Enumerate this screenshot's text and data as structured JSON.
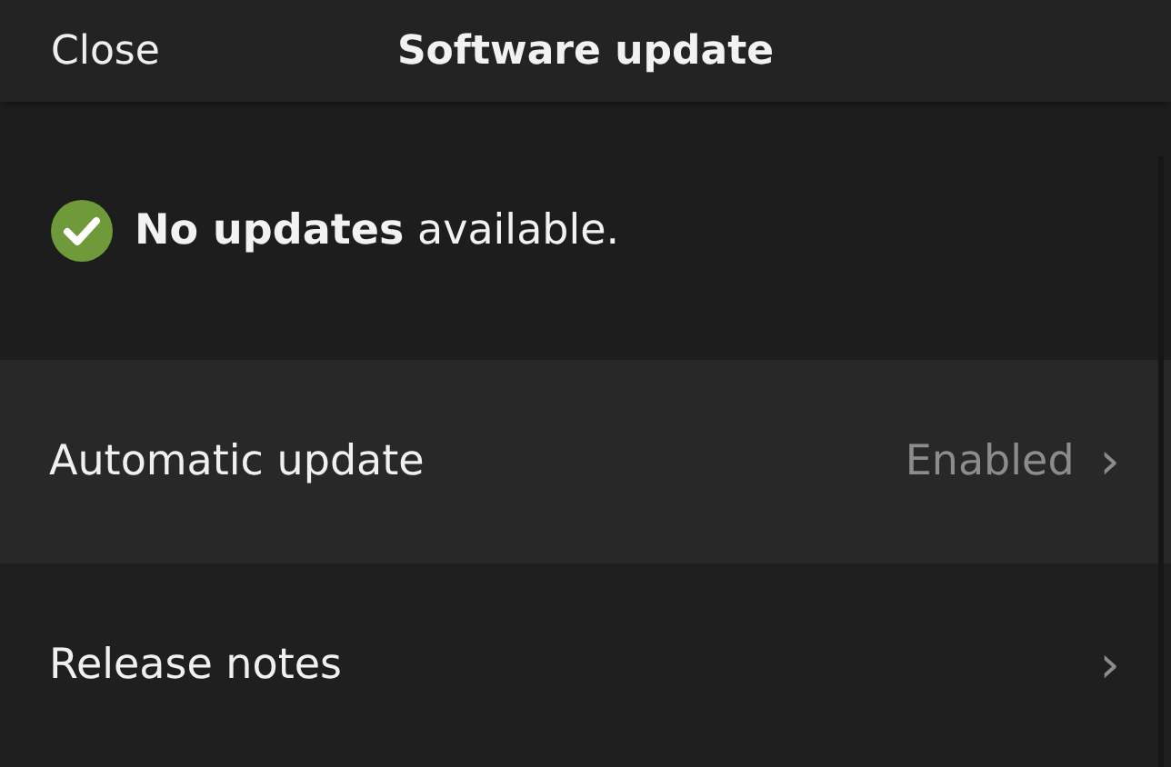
{
  "header": {
    "close": "Close",
    "title": "Software update"
  },
  "status": {
    "kind": "ok",
    "message": "**No updates** available."
  },
  "rows": [
    {
      "label": "Automatic update",
      "value": "Enabled",
      "chevron": "›"
    },
    {
      "label": "Release notes",
      "chevron": "›"
    }
  ]
}
